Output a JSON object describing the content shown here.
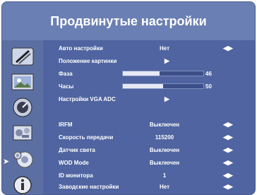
{
  "title": "Продвинутые настройки",
  "colors": {
    "panel": "#4f64a0",
    "frame": "#6a7fb3",
    "text": "#ffffff",
    "disabled_text": "#6d7fb3",
    "bar_fill": "#e6e9f4"
  },
  "sidebar": {
    "icons": [
      "pen-icon",
      "picture-icon",
      "dial-icon",
      "settings-icon",
      "advanced-gear-icon",
      "info-icon"
    ],
    "selected_index": 4,
    "selected_marker": "➤"
  },
  "menu": {
    "items": [
      {
        "label": "Авто настройки",
        "value": "Нет",
        "control": "arrows-lr"
      },
      {
        "label": "Положение картинки",
        "control": "arrow-right"
      },
      {
        "label": "Фаза",
        "value": "46",
        "level": 0.46,
        "control": "slider"
      },
      {
        "label": "Часы",
        "value": "50",
        "level": 0.5,
        "control": "slider"
      },
      {
        "label": "Настройки VGA ADC",
        "control": "arrow-right"
      },
      {
        "label": "",
        "value": "",
        "disabled": true
      },
      {
        "label": "IRFM",
        "value": "Выключен",
        "control": "arrows-lr"
      },
      {
        "label": "Скорость передачи",
        "value": "115200",
        "control": "arrows-lr"
      },
      {
        "label": "Датчик света",
        "value": "Выключен",
        "control": "arrows-lr"
      },
      {
        "label": "WOD Mode",
        "value": "Выключен",
        "control": "arrows-lr"
      },
      {
        "label": "ID монитора",
        "value": "1",
        "control": "arrows-lr"
      },
      {
        "label": "Заводские настройки",
        "value": "Нет",
        "control": "arrows-lr"
      }
    ],
    "arrow_right_glyph": "▶",
    "arrows_lr_glyph": "◀▶"
  }
}
